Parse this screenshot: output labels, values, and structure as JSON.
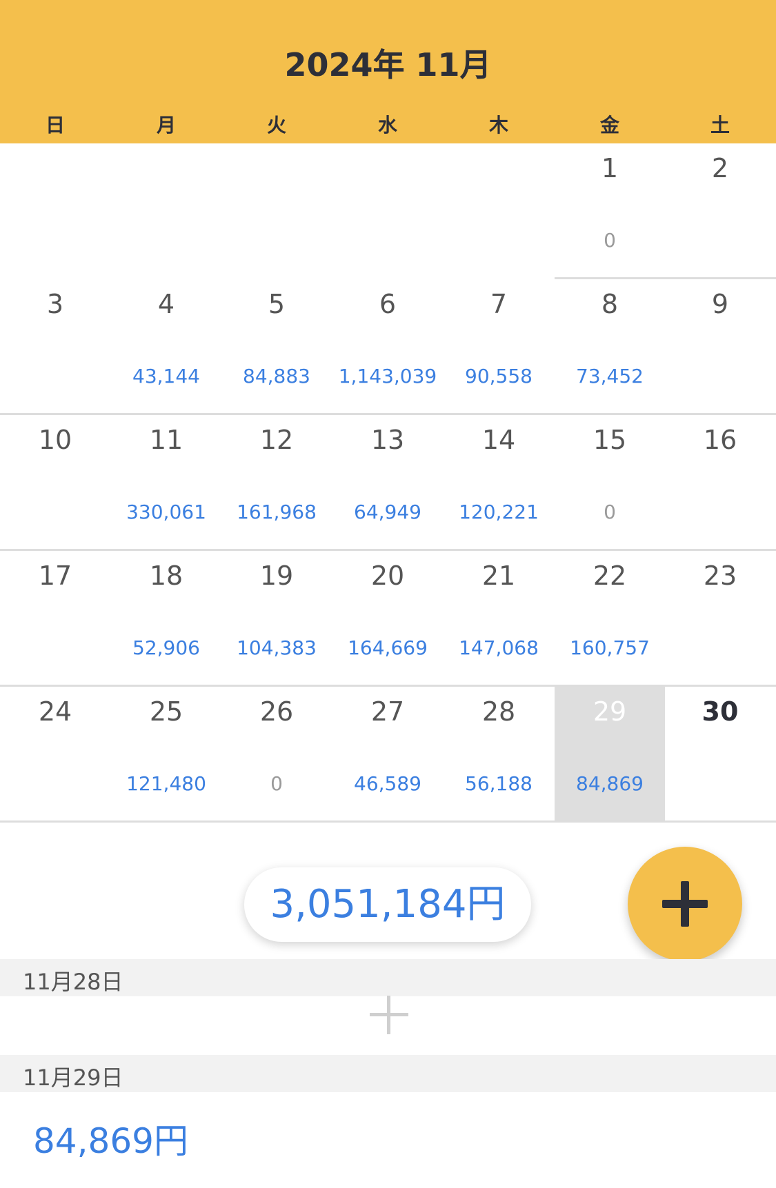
{
  "header": {
    "title": "2024年 11月",
    "weekdays": [
      "日",
      "月",
      "火",
      "水",
      "木",
      "金",
      "土"
    ]
  },
  "calendar": {
    "weeks": [
      [
        null,
        null,
        null,
        null,
        null,
        {
          "day": "1",
          "amount": "0"
        },
        {
          "day": "2",
          "amount": ""
        }
      ],
      [
        {
          "day": "3",
          "amount": ""
        },
        {
          "day": "4",
          "amount": "43,144"
        },
        {
          "day": "5",
          "amount": "84,883"
        },
        {
          "day": "6",
          "amount": "1,143,039"
        },
        {
          "day": "7",
          "amount": "90,558"
        },
        {
          "day": "8",
          "amount": "73,452"
        },
        {
          "day": "9",
          "amount": ""
        }
      ],
      [
        {
          "day": "10",
          "amount": ""
        },
        {
          "day": "11",
          "amount": "330,061"
        },
        {
          "day": "12",
          "amount": "161,968"
        },
        {
          "day": "13",
          "amount": "64,949"
        },
        {
          "day": "14",
          "amount": "120,221"
        },
        {
          "day": "15",
          "amount": "0"
        },
        {
          "day": "16",
          "amount": ""
        }
      ],
      [
        {
          "day": "17",
          "amount": ""
        },
        {
          "day": "18",
          "amount": "52,906"
        },
        {
          "day": "19",
          "amount": "104,383"
        },
        {
          "day": "20",
          "amount": "164,669"
        },
        {
          "day": "21",
          "amount": "147,068"
        },
        {
          "day": "22",
          "amount": "160,757"
        },
        {
          "day": "23",
          "amount": ""
        }
      ],
      [
        {
          "day": "24",
          "amount": ""
        },
        {
          "day": "25",
          "amount": "121,480"
        },
        {
          "day": "26",
          "amount": "0"
        },
        {
          "day": "27",
          "amount": "46,589"
        },
        {
          "day": "28",
          "amount": "56,188"
        },
        {
          "day": "29",
          "amount": "84,869",
          "selected": true
        },
        {
          "day": "30",
          "amount": "",
          "today": true
        }
      ]
    ]
  },
  "total": {
    "label": "3,051,184円"
  },
  "fab": {
    "icon": "plus-icon"
  },
  "sections": [
    {
      "date": "11月28日",
      "entries": []
    },
    {
      "date": "11月29日",
      "entries": [
        {
          "amount": "84,869円"
        }
      ]
    }
  ],
  "colors": {
    "accent": "#F4BF4C",
    "amount": "#3b7fe0",
    "zero": "#9a9a9a",
    "selected": "#dedede"
  }
}
